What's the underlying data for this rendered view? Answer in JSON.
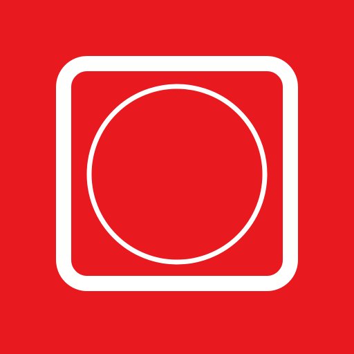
{
  "icon": {
    "name": "rounded-square-circle-icon",
    "background_color": "#E8191F",
    "stroke_color": "#FFFFFF"
  }
}
